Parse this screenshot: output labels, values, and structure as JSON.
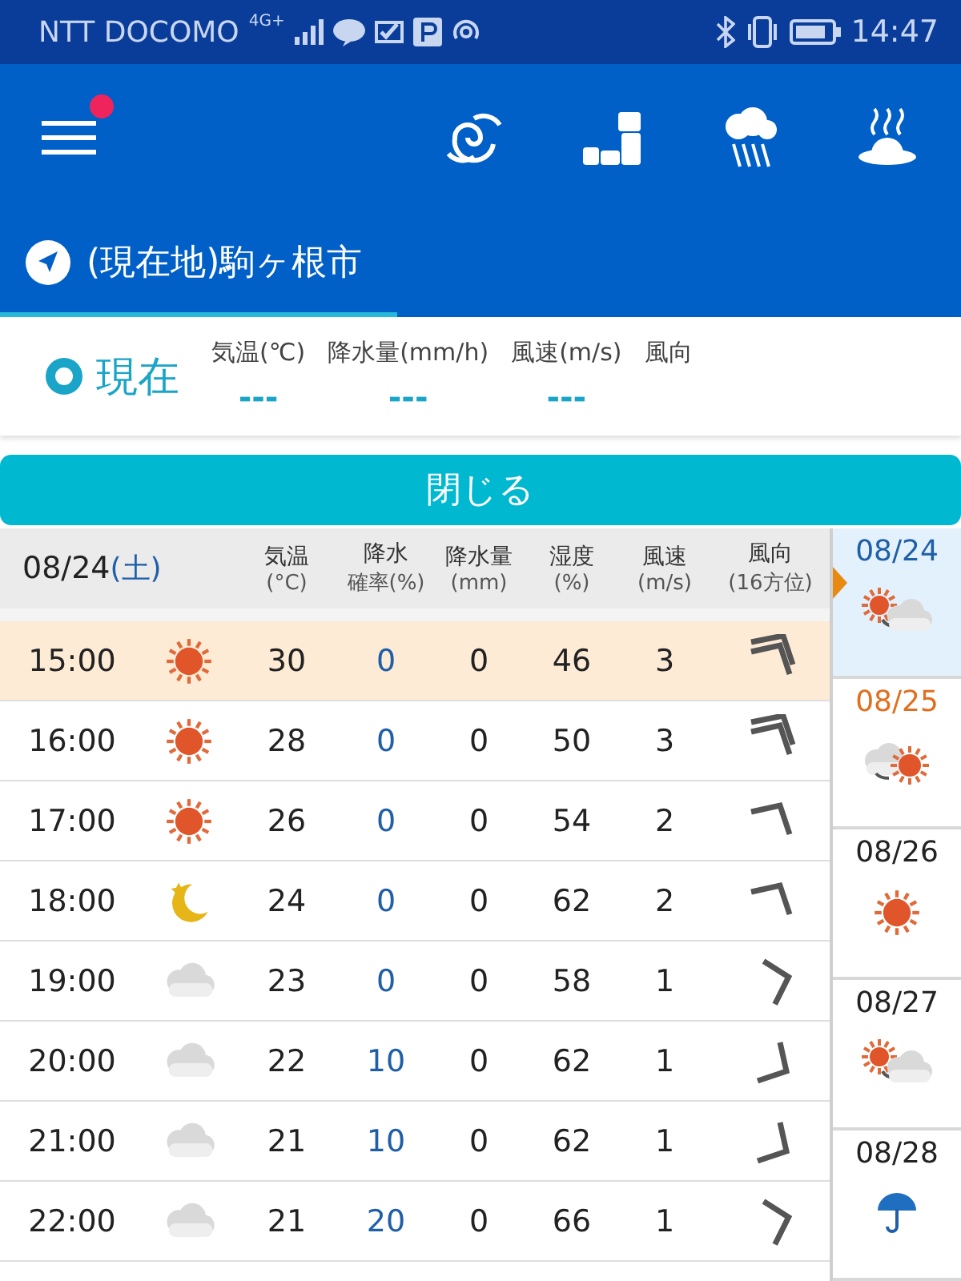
{
  "status_bar": {
    "carrier": "NTT DOCOMO",
    "network": "4G+",
    "time": "14:47"
  },
  "app_bar": {
    "menu_badge": true
  },
  "location": {
    "name": "(現在地)駒ヶ根市",
    "selected": true
  },
  "current": {
    "title": "現在",
    "items": [
      {
        "label": "気温(℃)",
        "value": "---"
      },
      {
        "label": "降水量(mm/h)",
        "value": "---"
      },
      {
        "label": "風速(m/s)",
        "value": "---"
      },
      {
        "label": "風向"
      }
    ]
  },
  "close_button": "閉じる",
  "table": {
    "date": "08/24",
    "weekday": "(土)",
    "columns": [
      {
        "label": "気温",
        "unit": "(°C)"
      },
      {
        "label": "降水",
        "unit": "確率(%)"
      },
      {
        "label": "降水量",
        "unit": "(mm)"
      },
      {
        "label": "湿度",
        "unit": "(%)"
      },
      {
        "label": "風速",
        "unit": "(m/s)"
      },
      {
        "label": "風向",
        "unit": "(16方位)"
      }
    ],
    "rows": [
      {
        "time": "15:00",
        "weather": {
          "kind": "sun"
        },
        "temp": "30",
        "pop": "0",
        "precip": "0",
        "humidity": "46",
        "wind": "3",
        "arrow": {
          "kind": "ne",
          "double": true
        },
        "selected": true
      },
      {
        "time": "16:00",
        "weather": {
          "kind": "sun"
        },
        "temp": "28",
        "pop": "0",
        "precip": "0",
        "humidity": "50",
        "wind": "3",
        "arrow": {
          "kind": "ne",
          "double": true
        },
        "selected": false
      },
      {
        "time": "17:00",
        "weather": {
          "kind": "sun"
        },
        "temp": "26",
        "pop": "0",
        "precip": "0",
        "humidity": "54",
        "wind": "2",
        "arrow": {
          "kind": "ne",
          "double": false
        },
        "selected": false
      },
      {
        "time": "18:00",
        "weather": {
          "kind": "moon"
        },
        "temp": "24",
        "pop": "0",
        "precip": "0",
        "humidity": "62",
        "wind": "2",
        "arrow": {
          "kind": "ne",
          "double": false
        },
        "selected": false
      },
      {
        "time": "19:00",
        "weather": {
          "kind": "cloud"
        },
        "temp": "23",
        "pop": "0",
        "precip": "0",
        "humidity": "58",
        "wind": "1",
        "arrow": {
          "kind": "e",
          "double": false
        },
        "selected": false
      },
      {
        "time": "20:00",
        "weather": {
          "kind": "cloud"
        },
        "temp": "22",
        "pop": "10",
        "precip": "0",
        "humidity": "62",
        "wind": "1",
        "arrow": {
          "kind": "se",
          "double": false
        },
        "selected": false
      },
      {
        "time": "21:00",
        "weather": {
          "kind": "cloud"
        },
        "temp": "21",
        "pop": "10",
        "precip": "0",
        "humidity": "62",
        "wind": "1",
        "arrow": {
          "kind": "se",
          "double": false
        },
        "selected": false
      },
      {
        "time": "22:00",
        "weather": {
          "kind": "cloud"
        },
        "temp": "21",
        "pop": "20",
        "precip": "0",
        "humidity": "66",
        "wind": "1",
        "arrow": {
          "kind": "e",
          "double": false
        },
        "selected": false
      }
    ]
  },
  "days": [
    {
      "date": "08/24",
      "weather": {
        "kind": "sun-cloud"
      },
      "color": "#1f5fa8",
      "selected": true
    },
    {
      "date": "08/25",
      "weather": {
        "kind": "cloud-sun"
      },
      "color": "#e07020",
      "selected": false
    },
    {
      "date": "08/26",
      "weather": {
        "kind": "sun"
      },
      "color": "#222222",
      "selected": false
    },
    {
      "date": "08/27",
      "weather": {
        "kind": "sun-cloud"
      },
      "color": "#222222",
      "selected": false
    },
    {
      "date": "08/28",
      "weather": {
        "kind": "rain"
      },
      "color": "#222222",
      "selected": false
    }
  ]
}
